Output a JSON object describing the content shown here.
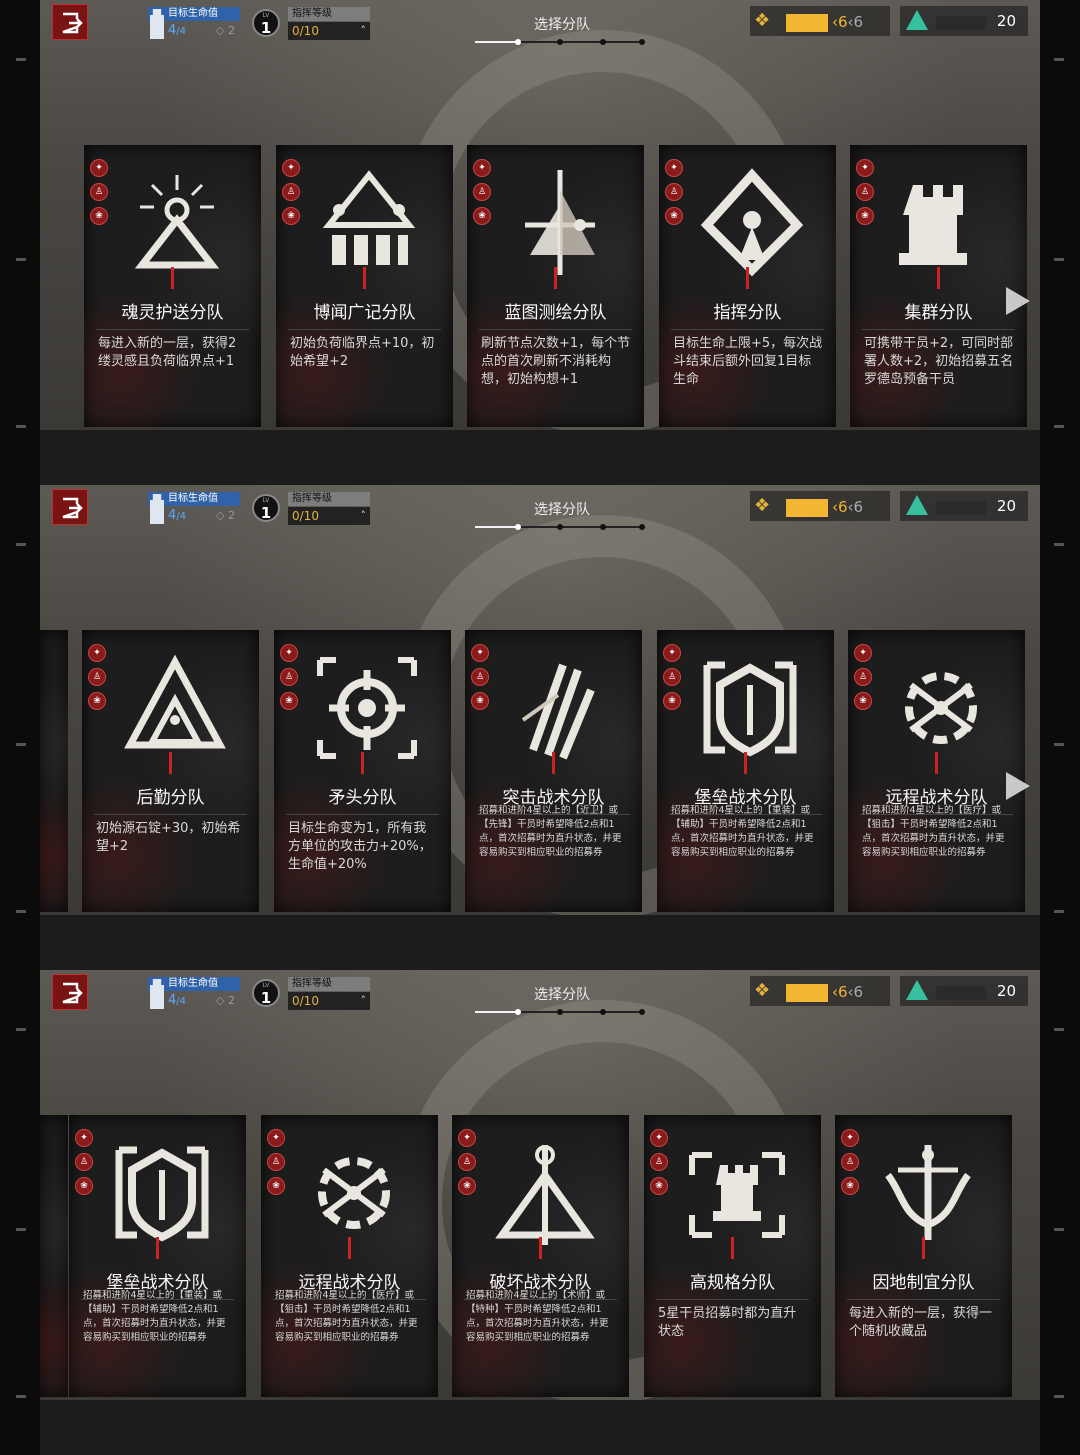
{
  "hud": {
    "hp_label": "目标生命值",
    "hp_value": "4",
    "hp_max": "/4",
    "shield_value": "2",
    "level_tag": "LV",
    "level": "1",
    "command_label": "指挥等级",
    "command_value": "0/10",
    "screen_title": "选择分队",
    "ingot_value": "6",
    "ingot_max": "6",
    "hope_value": "20",
    "progress_step": 1,
    "progress_total": 4,
    "colors": {
      "hp": "#2f62a8",
      "ingot": "#f2b632",
      "hope": "#36c0a0",
      "exit": "#7a1414"
    }
  },
  "screens": [
    {
      "cards": [
        {
          "name": "魂灵护送分队",
          "desc": "每进入新的一层，获得2缕灵感且负荷临界点+1",
          "small": false,
          "emblem": "spirit-icon"
        },
        {
          "name": "博闻广记分队",
          "desc": "初始负荷临界点+10，初始希望+2",
          "small": false,
          "emblem": "chronicle-icon"
        },
        {
          "name": "蓝图测绘分队",
          "desc": "刷新节点次数+1，每个节点的首次刷新不消耗构想，初始构想+1",
          "small": false,
          "emblem": "blueprint-icon"
        },
        {
          "name": "指挥分队",
          "desc": "目标生命上限+5，每次战斗结束后额外回复1目标生命",
          "small": false,
          "emblem": "command-icon"
        },
        {
          "name": "集群分队",
          "desc": "可携带干员+2，可同时部署人数+2，初始招募五名罗德岛预备干员",
          "small": false,
          "emblem": "rook-icon"
        }
      ]
    },
    {
      "cards": [
        {
          "name": "后勤分队",
          "desc": "初始源石锭+30，初始希望+2",
          "small": false,
          "emblem": "logistics-icon"
        },
        {
          "name": "矛头分队",
          "desc": "目标生命变为1，所有我方单位的攻击力+20%，生命值+20%",
          "small": false,
          "emblem": "crosshair-icon"
        },
        {
          "name": "突击战术分队",
          "desc": "招募和进阶4星以上的【近卫】或【先锋】干员时希望降低2点和1点，首次招募时为直升状态，并更容易购买到相应职业的招募券",
          "small": true,
          "emblem": "assault-icon"
        },
        {
          "name": "堡垒战术分队",
          "desc": "招募和进阶4星以上的【重装】或【辅助】干员时希望降低2点和1点，首次招募时为直升状态，并更容易购买到相应职业的招募券",
          "small": true,
          "emblem": "shield-icon"
        },
        {
          "name": "远程战术分队",
          "desc": "招募和进阶4星以上的【医疗】或【狙击】干员时希望降低2点和1点，首次招募时为直升状态，并更容易购买到相应职业的招募券",
          "small": true,
          "emblem": "crossbow-icon"
        }
      ]
    },
    {
      "cards": [
        {
          "name": "堡垒战术分队",
          "desc": "招募和进阶4星以上的【重装】或【辅助】干员时希望降低2点和1点，首次招募时为直升状态，并更容易购买到相应职业的招募券",
          "small": true,
          "emblem": "shield-icon"
        },
        {
          "name": "远程战术分队",
          "desc": "招募和进阶4星以上的【医疗】或【狙击】干员时希望降低2点和1点，首次招募时为直升状态，并更容易购买到相应职业的招募券",
          "small": true,
          "emblem": "crossbow-icon"
        },
        {
          "name": "破坏战术分队",
          "desc": "招募和进阶4星以上的【术师】或【特种】干员时希望降低2点和1点，首次招募时为直升状态，并更容易购买到相应职业的招募券",
          "small": true,
          "emblem": "destruction-icon"
        },
        {
          "name": "高规格分队",
          "desc": "5星干员招募时都为直升状态",
          "small": false,
          "emblem": "elite-rook-icon"
        },
        {
          "name": "因地制宜分队",
          "desc": "每进入新的一层，获得一个随机收藏品",
          "small": false,
          "emblem": "adapt-icon"
        }
      ]
    }
  ]
}
